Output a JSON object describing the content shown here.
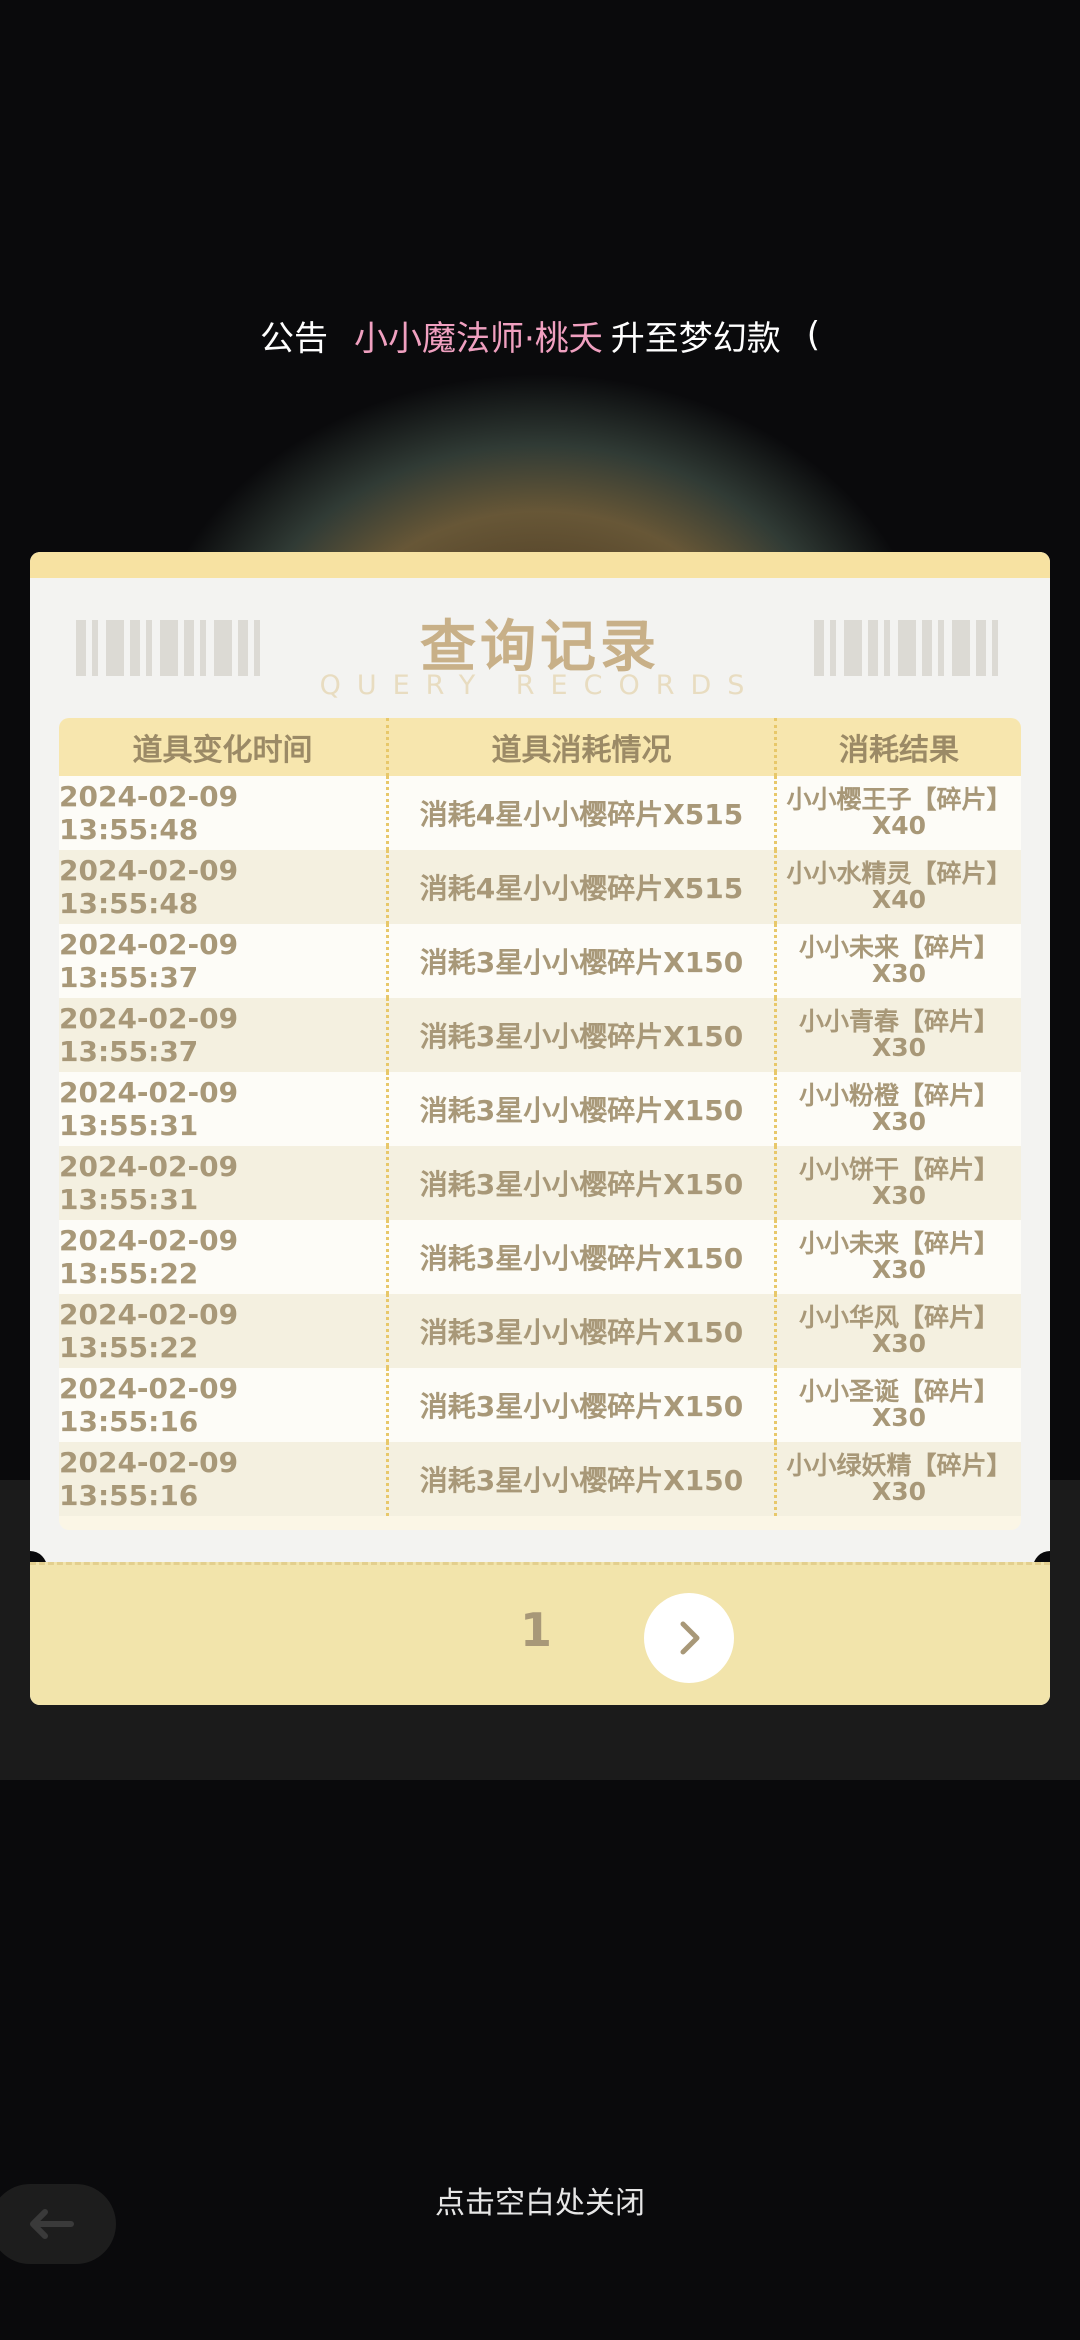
{
  "announcement": {
    "label": "公告",
    "highlight": "小小魔法师·桃夭",
    "text": "升至梦幻款",
    "trailing": "("
  },
  "dialog": {
    "title": "查询记录",
    "subtitle": "QUERY RECORDS",
    "columns": [
      "道具变化时间",
      "道具消耗情况",
      "消耗结果"
    ],
    "rows": [
      {
        "time": "2024-02-09 13:55:48",
        "consume": "消耗4星小小樱碎片X515",
        "result": "小小樱王子【碎片】X40"
      },
      {
        "time": "2024-02-09 13:55:48",
        "consume": "消耗4星小小樱碎片X515",
        "result": "小小水精灵【碎片】X40"
      },
      {
        "time": "2024-02-09 13:55:37",
        "consume": "消耗3星小小樱碎片X150",
        "result": "小小未来【碎片】X30"
      },
      {
        "time": "2024-02-09 13:55:37",
        "consume": "消耗3星小小樱碎片X150",
        "result": "小小青春【碎片】X30"
      },
      {
        "time": "2024-02-09 13:55:31",
        "consume": "消耗3星小小樱碎片X150",
        "result": "小小粉橙【碎片】X30"
      },
      {
        "time": "2024-02-09 13:55:31",
        "consume": "消耗3星小小樱碎片X150",
        "result": "小小饼干【碎片】X30"
      },
      {
        "time": "2024-02-09 13:55:22",
        "consume": "消耗3星小小樱碎片X150",
        "result": "小小未来【碎片】X30"
      },
      {
        "time": "2024-02-09 13:55:22",
        "consume": "消耗3星小小樱碎片X150",
        "result": "小小华风【碎片】X30"
      },
      {
        "time": "2024-02-09 13:55:16",
        "consume": "消耗3星小小樱碎片X150",
        "result": "小小圣诞【碎片】X30"
      },
      {
        "time": "2024-02-09 13:55:16",
        "consume": "消耗3星小小樱碎片X150",
        "result": "小小绿妖精【碎片】X30"
      }
    ],
    "page": "1",
    "next_icon": "chevron-right-icon"
  },
  "close_hint": "点击空白处关闭",
  "back_icon": "back-arrow-icon",
  "colors": {
    "modal_bg": "#f3f3f1",
    "header_bg": "#f7e6ae",
    "footer_bg": "#f2e4ab",
    "text": "#a89878",
    "highlight": "#f0a0c0"
  }
}
